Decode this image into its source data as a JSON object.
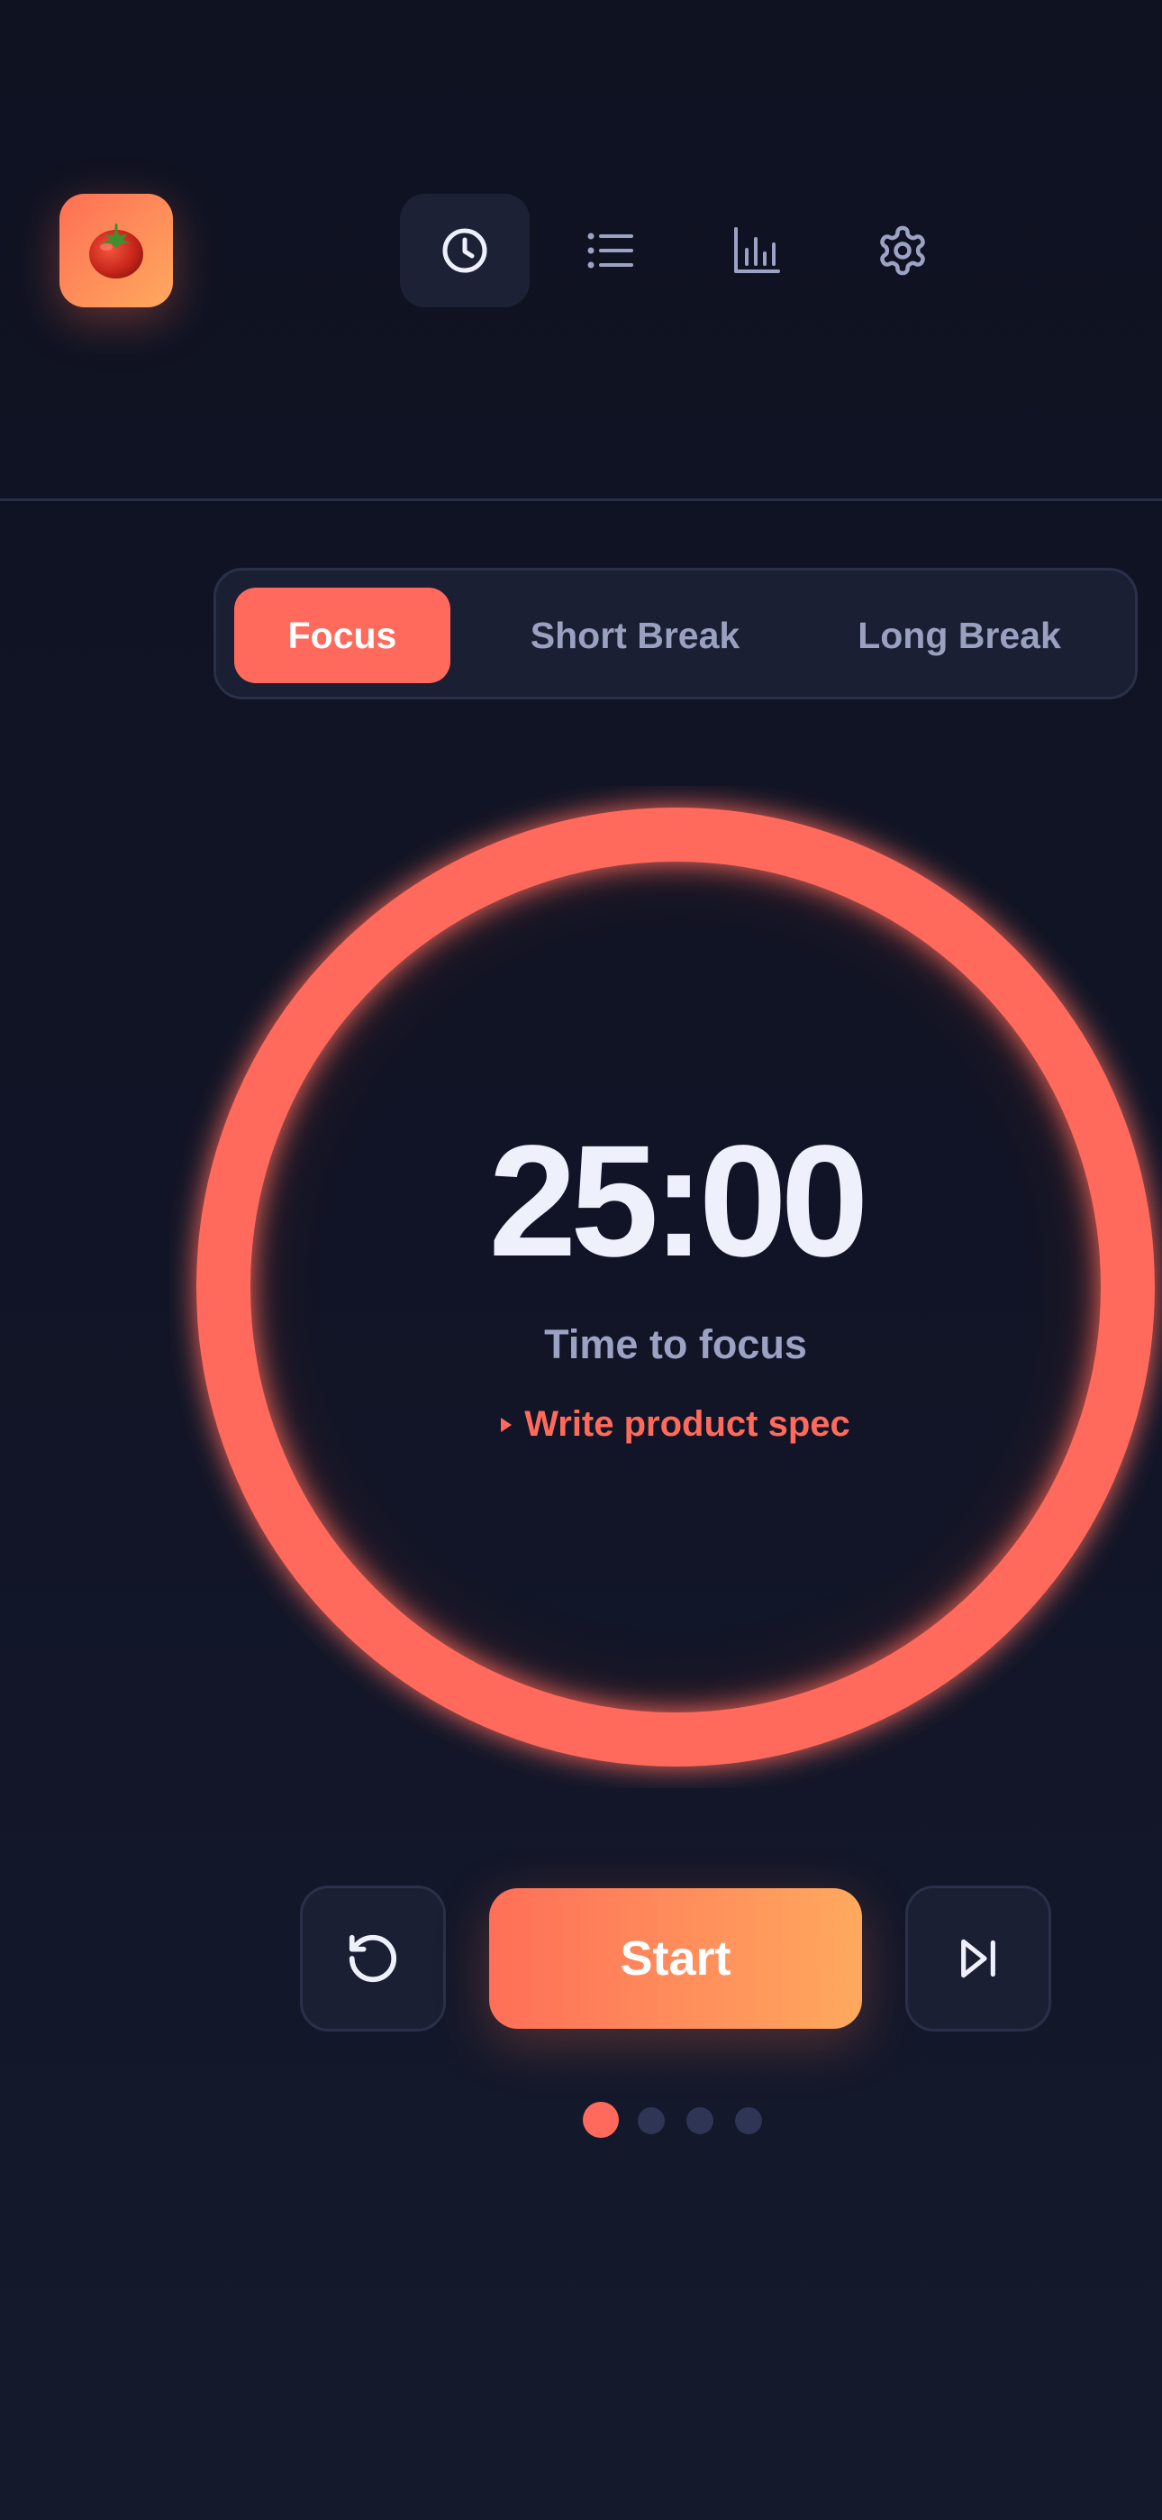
{
  "app": {
    "logo_emoji": "🍅",
    "logo_icon": "tomato-icon"
  },
  "nav": {
    "items": [
      {
        "id": "timer",
        "icon": "clock-icon",
        "active": true
      },
      {
        "id": "tasks",
        "icon": "list-icon",
        "active": false
      },
      {
        "id": "stats",
        "icon": "bar-chart-icon",
        "active": false
      },
      {
        "id": "settings",
        "icon": "gear-icon",
        "active": false
      }
    ]
  },
  "modes": {
    "tabs": [
      {
        "label": "Focus",
        "active": true
      },
      {
        "label": "Short Break",
        "active": false
      },
      {
        "label": "Long Break",
        "active": false
      }
    ]
  },
  "timer": {
    "time": "25:00",
    "status": "Time to focus",
    "task": "Write product spec",
    "progress": 1.0
  },
  "controls": {
    "reset_icon": "reset-icon",
    "start_label": "Start",
    "skip_icon": "skip-icon"
  },
  "sessions": {
    "total": 4,
    "current": 1
  },
  "colors": {
    "accent": "#ff6a5c",
    "accent_gradient_end": "#ffa95e",
    "background": "#0f1221",
    "surface": "#1a1f33",
    "text_primary": "#eef1fc",
    "text_secondary": "#9ca2c3"
  }
}
